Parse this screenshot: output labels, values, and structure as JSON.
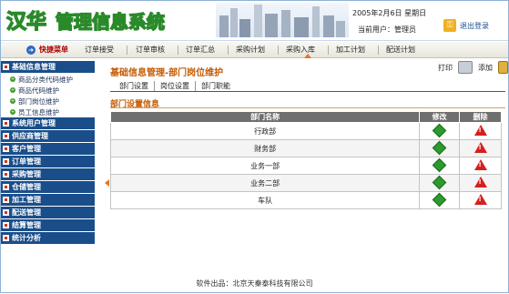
{
  "header": {
    "logo_text": "汉华管理信息系统",
    "date": "2005年2月6日  星期日",
    "user_label": "当前用户：管理员",
    "logout_label": "退出登录"
  },
  "nav": {
    "quick_label": "快捷菜单",
    "items": [
      "订单接受",
      "订单审核",
      "订单汇总",
      "采购计划",
      "采购入库",
      "加工计划",
      "配送计划"
    ]
  },
  "sidebar": {
    "open_section": "基础信息管理",
    "sub_items": [
      "商品分类代码维护",
      "商品代码维护",
      "部门岗位维护",
      "员工信息维护"
    ],
    "sections": [
      "系统用户管理",
      "供应商管理",
      "客户管理",
      "订单管理",
      "采购管理",
      "仓储管理",
      "加工管理",
      "配送管理",
      "结算管理",
      "统计分析"
    ]
  },
  "main": {
    "title": "基础信息管理-部门岗位维护",
    "print_label": "打印",
    "add_label": "添加",
    "tabs": [
      "部门设置",
      "岗位设置",
      "部门职能"
    ],
    "section_title": "部门设置信息",
    "table": {
      "headers": [
        "部门名称",
        "修改",
        "删除"
      ],
      "rows": [
        "行政部",
        "财务部",
        "业务一部",
        "业务二部",
        "车队"
      ]
    }
  },
  "footer": {
    "text": "软件出品：北京天秦泰科技有限公司"
  },
  "colors": {
    "sidebar": "#1a4e8a",
    "accent": "#c45a00",
    "edit": "#2d9a2d",
    "delete": "#d42020"
  }
}
